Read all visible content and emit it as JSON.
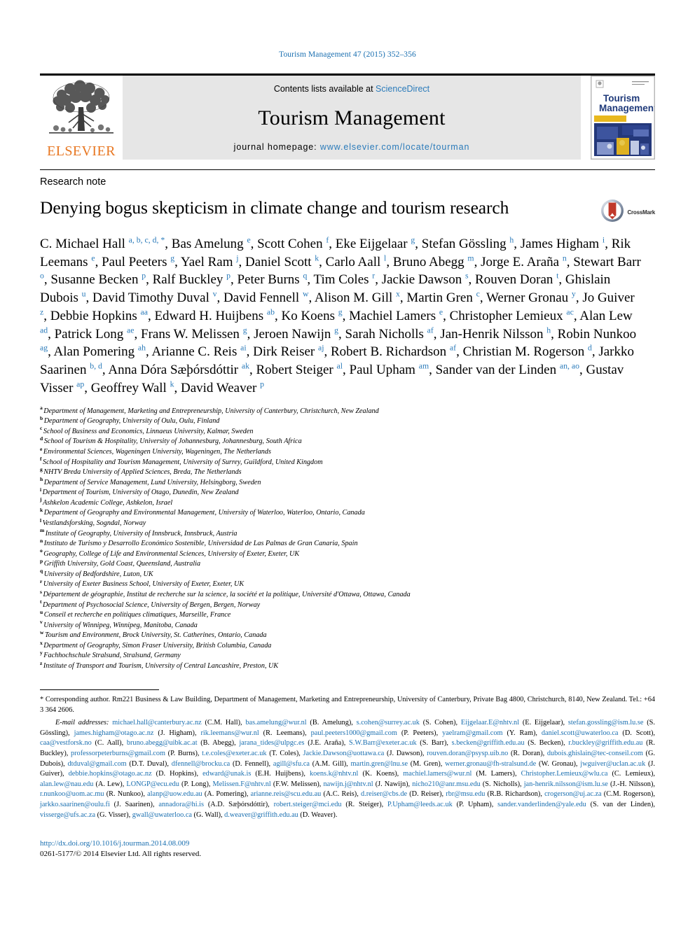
{
  "running_head": "Tourism Management 47 (2015) 352–356",
  "masthead": {
    "publisher_name": "ELSEVIER",
    "contents_prefix": "Contents lists available at ",
    "contents_link": "ScienceDirect",
    "journal_title": "Tourism Management",
    "homepage_prefix": "journal homepage: ",
    "homepage_url": "www.elsevier.com/locate/tourman",
    "cover_title_line1": "Tourism",
    "cover_title_line2": "Management"
  },
  "article": {
    "note_type": "Research note",
    "title": "Denying bogus skepticism in climate change and tourism research",
    "crossmark_label": "CrossMark"
  },
  "authors_html": "C. Michael Hall <sup>a, b, c, d, *</sup>, Bas Amelung <sup>e</sup>, Scott Cohen <sup>f</sup>, Eke Eijgelaar <sup>g</sup>, Stefan G&ouml;ssling <sup>h</sup>, James Higham <sup>i</sup>, Rik Leemans <sup>e</sup>, Paul Peeters <sup>g</sup>, Yael Ram <sup>j</sup>, Daniel Scott <sup>k</sup>, Carlo Aall <sup>l</sup>, Bruno Abegg <sup>m</sup>, Jorge E. Ara&ntilde;a <sup>n</sup>, Stewart Barr <sup>o</sup>, Susanne Becken <sup>p</sup>, Ralf Buckley <sup>p</sup>, Peter Burns <sup>q</sup>, Tim Coles <sup>r</sup>, Jackie Dawson <sup>s</sup>, Rouven Doran <sup>t</sup>, Ghislain Dubois <sup>u</sup>, David Timothy Duval <sup>v</sup>, David Fennell <sup>w</sup>, Alison M. Gill <sup>x</sup>, Martin Gren <sup>c</sup>, Werner Gronau <sup>y</sup>, Jo Guiver <sup>z</sup>, Debbie Hopkins <sup>aa</sup>, Edward H. Huijbens <sup>ab</sup>, Ko Koens <sup>g</sup>, Machiel Lamers <sup>e</sup>, Christopher Lemieux <sup>ac</sup>, Alan Lew <sup>ad</sup>, Patrick Long <sup>ae</sup>, Frans W. Melissen <sup>g</sup>, Jeroen Nawijn <sup>g</sup>, Sarah Nicholls <sup>af</sup>, Jan-Henrik Nilsson <sup>h</sup>, Robin Nunkoo <sup>ag</sup>, Alan Pomering <sup>ah</sup>, Arianne C. Reis <sup>ai</sup>, Dirk Reiser <sup>aj</sup>, Robert B. Richardson <sup>af</sup>, Christian M. Rogerson <sup>d</sup>, Jarkko Saarinen <sup>b, d</sup>, Anna D&oacute;ra S&aelig;&thorn;&oacute;rsd&oacute;ttir <sup>ak</sup>, Robert Steiger <sup>al</sup>, Paul Upham <sup>am</sup>, Sander van der Linden <sup>an, ao</sup>, Gustav Visser <sup>ap</sup>, Geoffrey Wall <sup>k</sup>, David Weaver <sup>p</sup>",
  "affiliations": [
    {
      "mark": "a",
      "text": "Department of Management, Marketing and Entrepreneurship, University of Canterbury, Christchurch, New Zealand"
    },
    {
      "mark": "b",
      "text": "Department of Geography, University of Oulu, Oulu, Finland"
    },
    {
      "mark": "c",
      "text": "School of Business and Economics, Linnaeus University, Kalmar, Sweden"
    },
    {
      "mark": "d",
      "text": "School of Tourism & Hospitality, University of Johannesburg, Johannesburg, South Africa"
    },
    {
      "mark": "e",
      "text": "Environmental Sciences, Wageningen University, Wageningen, The Netherlands"
    },
    {
      "mark": "f",
      "text": "School of Hospitality and Tourism Management, University of Surrey, Guildford, United Kingdom"
    },
    {
      "mark": "g",
      "text": "NHTV Breda University of Applied Sciences, Breda, The Netherlands"
    },
    {
      "mark": "h",
      "text": "Department of Service Management, Lund University, Helsingborg, Sweden"
    },
    {
      "mark": "i",
      "text": "Department of Tourism, University of Otago, Dunedin, New Zealand"
    },
    {
      "mark": "j",
      "text": "Ashkelon Academic College, Ashkelon, Israel"
    },
    {
      "mark": "k",
      "text": "Department of Geography and Environmental Management, University of Waterloo, Waterloo, Ontario, Canada"
    },
    {
      "mark": "l",
      "text": "Vestlandsforsking, Sogndal, Norway"
    },
    {
      "mark": "m",
      "text": "Institute of Geography, University of Innsbruck, Innsbruck, Austria"
    },
    {
      "mark": "n",
      "text": "Instituto de Turismo y Desarrollo Económico Sostenible, Universidad de Las Palmas de Gran Canaria, Spain"
    },
    {
      "mark": "o",
      "text": "Geography, College of Life and Environmental Sciences, University of Exeter, Exeter, UK"
    },
    {
      "mark": "p",
      "text": "Griffith University, Gold Coast, Queensland, Australia"
    },
    {
      "mark": "q",
      "text": "University of Bedfordshire, Luton, UK"
    },
    {
      "mark": "r",
      "text": "University of Exeter Business School, University of Exeter, Exeter, UK"
    },
    {
      "mark": "s",
      "text": "Département de géographie, Institut de recherche sur la science, la société et la politique, Université d'Ottawa, Ottawa, Canada"
    },
    {
      "mark": "t",
      "text": "Department of Psychosocial Science, University of Bergen, Bergen, Norway"
    },
    {
      "mark": "u",
      "text": "Conseil et recherche en politiques climatiques, Marseille, France"
    },
    {
      "mark": "v",
      "text": "University of Winnipeg, Winnipeg, Manitoba, Canada"
    },
    {
      "mark": "w",
      "text": "Tourism and Environment, Brock University, St. Catherines, Ontario, Canada"
    },
    {
      "mark": "x",
      "text": "Department of Geography, Simon Fraser University, British Columbia, Canada"
    },
    {
      "mark": "y",
      "text": "Fachhochschule Stralsund, Stralsund, Germany"
    },
    {
      "mark": "z",
      "text": "Institute of Transport and Tourism, University of Central Lancashire, Preston, UK"
    }
  ],
  "footnotes": {
    "corresponding": "* Corresponding author. Rm221 Business & Law Building, Department of Management, Marketing and Entrepreneurship, University of Canterbury, Private Bag 4800, Christchurch, 8140, New Zealand. Tel.: +64 3 364 2606.",
    "emails_label": "E-mail addresses:",
    "emails_html": "<span class=\"mail\">michael.hall@canterbury.ac.nz</span> (C.M. Hall), <span class=\"mail\">bas.amelung@wur.nl</span> (B. Amelung), <span class=\"mail\">s.cohen@surrey.ac.uk</span> (S. Cohen), <span class=\"mail\">Eijgelaar.E@nhtv.nl</span> (E. Eijgelaar), <span class=\"mail\">stefan.gossling@ism.lu.se</span> (S. G&ouml;ssling), <span class=\"mail\">james.higham@otago.ac.nz</span> (J. Higham), <span class=\"mail\">rik.leemans@wur.nl</span> (R. Leemans), <span class=\"mail\">paul.peeters1000@gmail.com</span> (P. Peeters), <span class=\"mail\">yaelram@gmail.com</span> (Y. Ram), <span class=\"mail\">daniel.scott@uwaterloo.ca</span> (D. Scott), <span class=\"mail\">caa@vestforsk.no</span> (C. Aall), <span class=\"mail\">bruno.abegg@uibk.ac.at</span> (B. Abegg), <span class=\"mail\">jarana_tides@ulpgc.es</span> (J.E. Ara&ntilde;a), <span class=\"mail\">S.W.Barr@exeter.ac.uk</span> (S. Barr), <span class=\"mail\">s.becken@griffith.edu.au</span> (S. Becken), <span class=\"mail\">r.buckley@griffith.edu.au</span> (R. Buckley), <span class=\"mail\">professorpeterburns@gmail.com</span> (P. Burns), <span class=\"mail\">t.e.coles@exeter.ac.uk</span> (T. Coles), <span class=\"mail\">Jackie.Dawson@uottawa.ca</span> (J. Dawson), <span class=\"mail\">rouven.doran@psysp.uib.no</span> (R. Doran), <span class=\"mail\">dubois.ghislain@tec-conseil.com</span> (G. Dubois), <span class=\"mail\">dtduval@gmail.com</span> (D.T. Duval), <span class=\"mail\">dfennell@brocku.ca</span> (D. Fennell), <span class=\"mail\">agill@sfu.ca</span> (A.M. Gill), <span class=\"mail\">martin.gren@lnu.se</span> (M. Gren), <span class=\"mail\">werner.gronau@fh-stralsund.de</span> (W. Gronau), <span class=\"mail\">jwguiver@uclan.ac.uk</span> (J. Guiver), <span class=\"mail\">debbie.hopkins@otago.ac.nz</span> (D. Hopkins), <span class=\"mail\">edward@unak.is</span> (E.H. Huijbens), <span class=\"mail\">koens.k@nhtv.nl</span> (K. Koens), <span class=\"mail\">machiel.lamers@wur.nl</span> (M. Lamers), <span class=\"mail\">Christopher.Lemieux@wlu.ca</span> (C. Lemieux), <span class=\"mail\">alan.lew@nau.edu</span> (A. Lew), <span class=\"mail\">LONGP@ecu.edu</span> (P. Long), <span class=\"mail\">Melissen.F@nhtv.nl</span> (F.W. Melissen), <span class=\"mail\">nawijn.j@nhtv.nl</span> (J. Nawijn), <span class=\"mail\">nicho210@anr.msu.edu</span> (S. Nicholls), <span class=\"mail\">jan-henrik.nilsson@ism.lu.se</span> (J.-H. Nilsson), <span class=\"mail\">r.nunkoo@uom.ac.mu</span> (R. Nunkoo), <span class=\"mail\">alanp@uow.edu.au</span> (A. Pomering), <span class=\"mail\">arianne.reis@scu.edu.au</span> (A.C. Reis), <span class=\"mail\">d.reiser@cbs.de</span> (D. Reiser), <span class=\"mail\">rbr@msu.edu</span> (R.B. Richardson), <span class=\"mail\">crogerson@uj.ac.za</span> (C.M. Rogerson), <span class=\"mail\">jarkko.saarinen@oulu.fi</span> (J. Saarinen), <span class=\"mail\">annadora@hi.is</span> (A.D. S&aelig;&thorn;&oacute;rsd&oacute;ttir), <span class=\"mail\">robert.steiger@mci.edu</span> (R. Steiger), <span class=\"mail\">P.Upham@leeds.ac.uk</span> (P. Upham), <span class=\"mail\">sander.vanderlinden@yale.edu</span> (S. van der Linden), <span class=\"mail\">visserge@ufs.ac.za</span> (G. Visser), <span class=\"mail\">gwall@uwaterloo.ca</span> (G. Wall), <span class=\"mail\">d.weaver@griffith.edu.au</span> (D. Weaver).",
    "doi": "http://dx.doi.org/10.1016/j.tourman.2014.08.009",
    "copyright": "0261-5177/© 2014 Elsevier Ltd. All rights reserved."
  }
}
